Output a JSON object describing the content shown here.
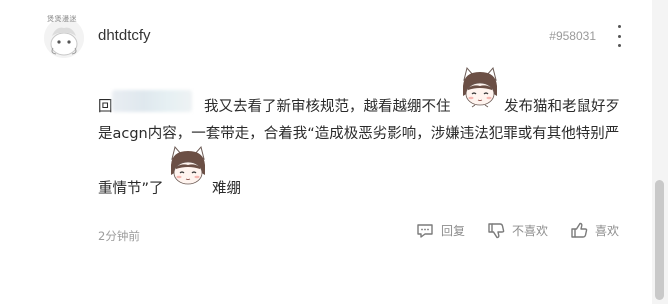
{
  "comment": {
    "avatar_badge": "煲煲漫迷",
    "username": "dhtdtcfy",
    "floor": "#958031",
    "more_icon": "more-vertical-icon",
    "body": {
      "line1_prefix": "回",
      "line1_middle": "我又去看了新审核规范，越看越绷不住",
      "line1_suffix": "发布猫和老鼠好歹",
      "line2": "是acgn内容，一套带走，合着我“造成极恶劣影响，涉嫌违法犯罪或有其他特别严",
      "line3_prefix": "重情节”了",
      "line3_suffix": "难绷"
    },
    "stickers": [
      "cat-ear-girl-sticker",
      "cat-ear-girl-sticker"
    ],
    "time": "2分钟前",
    "actions": {
      "reply_label": "回复",
      "dislike_label": "不喜欢",
      "like_label": "喜欢",
      "reply_icon": "comment-icon",
      "dislike_icon": "thumbs-down-icon",
      "like_icon": "thumbs-up-icon"
    }
  }
}
